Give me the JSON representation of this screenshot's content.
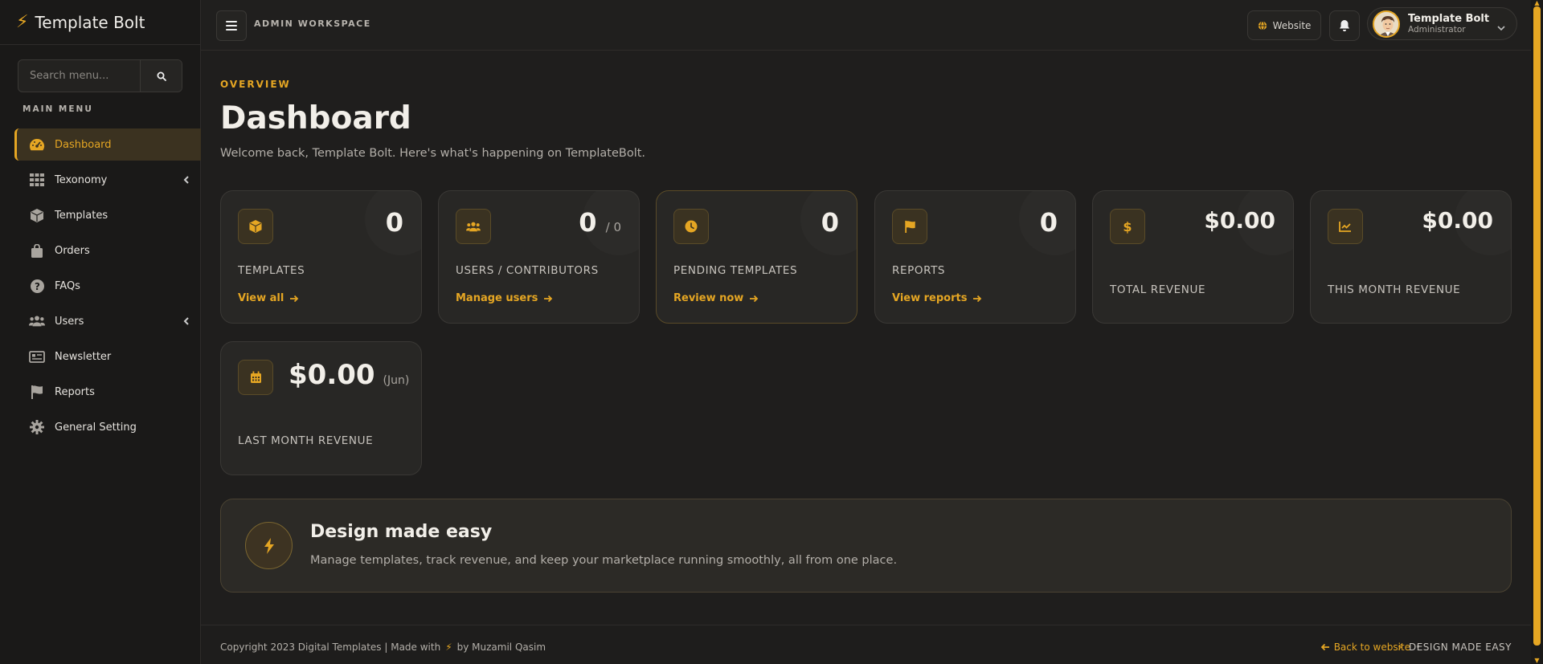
{
  "brand": {
    "name": "Template Bolt"
  },
  "search": {
    "placeholder": "Search menu..."
  },
  "sidebar": {
    "menu_label": "MAIN MENU",
    "items": [
      {
        "label": "Dashboard",
        "icon": "gauge-icon"
      },
      {
        "label": "Texonomy",
        "icon": "grid-icon"
      },
      {
        "label": "Templates",
        "icon": "box-icon"
      },
      {
        "label": "Orders",
        "icon": "bag-icon"
      },
      {
        "label": "FAQs",
        "icon": "question-icon"
      },
      {
        "label": "Users",
        "icon": "users-icon"
      },
      {
        "label": "Newsletter",
        "icon": "newspaper-icon"
      },
      {
        "label": "Reports",
        "icon": "flag-icon"
      },
      {
        "label": "General Setting",
        "icon": "gear-icon"
      }
    ]
  },
  "topbar": {
    "workspace": "ADMIN WORKSPACE",
    "website_label": "Website",
    "user_name": "Template Bolt",
    "user_role": "Administrator"
  },
  "header": {
    "overview": "OVERVIEW",
    "title": "Dashboard",
    "welcome": "Welcome back, Template Bolt. Here's what's happening on TemplateBolt."
  },
  "cards": {
    "templates": {
      "value": "0",
      "label": "TEMPLATES",
      "link": "View all"
    },
    "users": {
      "value": "0",
      "sub": "/ 0",
      "label": "USERS / CONTRIBUTORS",
      "link": "Manage users"
    },
    "pending": {
      "value": "0",
      "label": "PENDING TEMPLATES",
      "link": "Review now"
    },
    "reports": {
      "value": "0",
      "label": "REPORTS",
      "link": "View reports"
    },
    "total_revenue": {
      "value": "$0.00",
      "label": "TOTAL REVENUE"
    },
    "month_revenue": {
      "value": "$0.00",
      "label": "THIS MONTH REVENUE"
    },
    "last_month": {
      "value": "$0.00",
      "sub": "(Jun)",
      "label": "LAST MONTH REVENUE"
    }
  },
  "banner": {
    "title": "Design made easy",
    "text": "Manage templates, track revenue, and keep your marketplace running smoothly, all from one place."
  },
  "footer": {
    "copy_prefix": "Copyright 2023 Digital Templates | Made with",
    "copy_suffix": "by Muzamil Qasim",
    "back": "Back to website",
    "tagline": "DESIGN MADE EASY"
  },
  "colors": {
    "accent": "#e5a623",
    "background": "#1f1e1d",
    "card": "#282725"
  }
}
